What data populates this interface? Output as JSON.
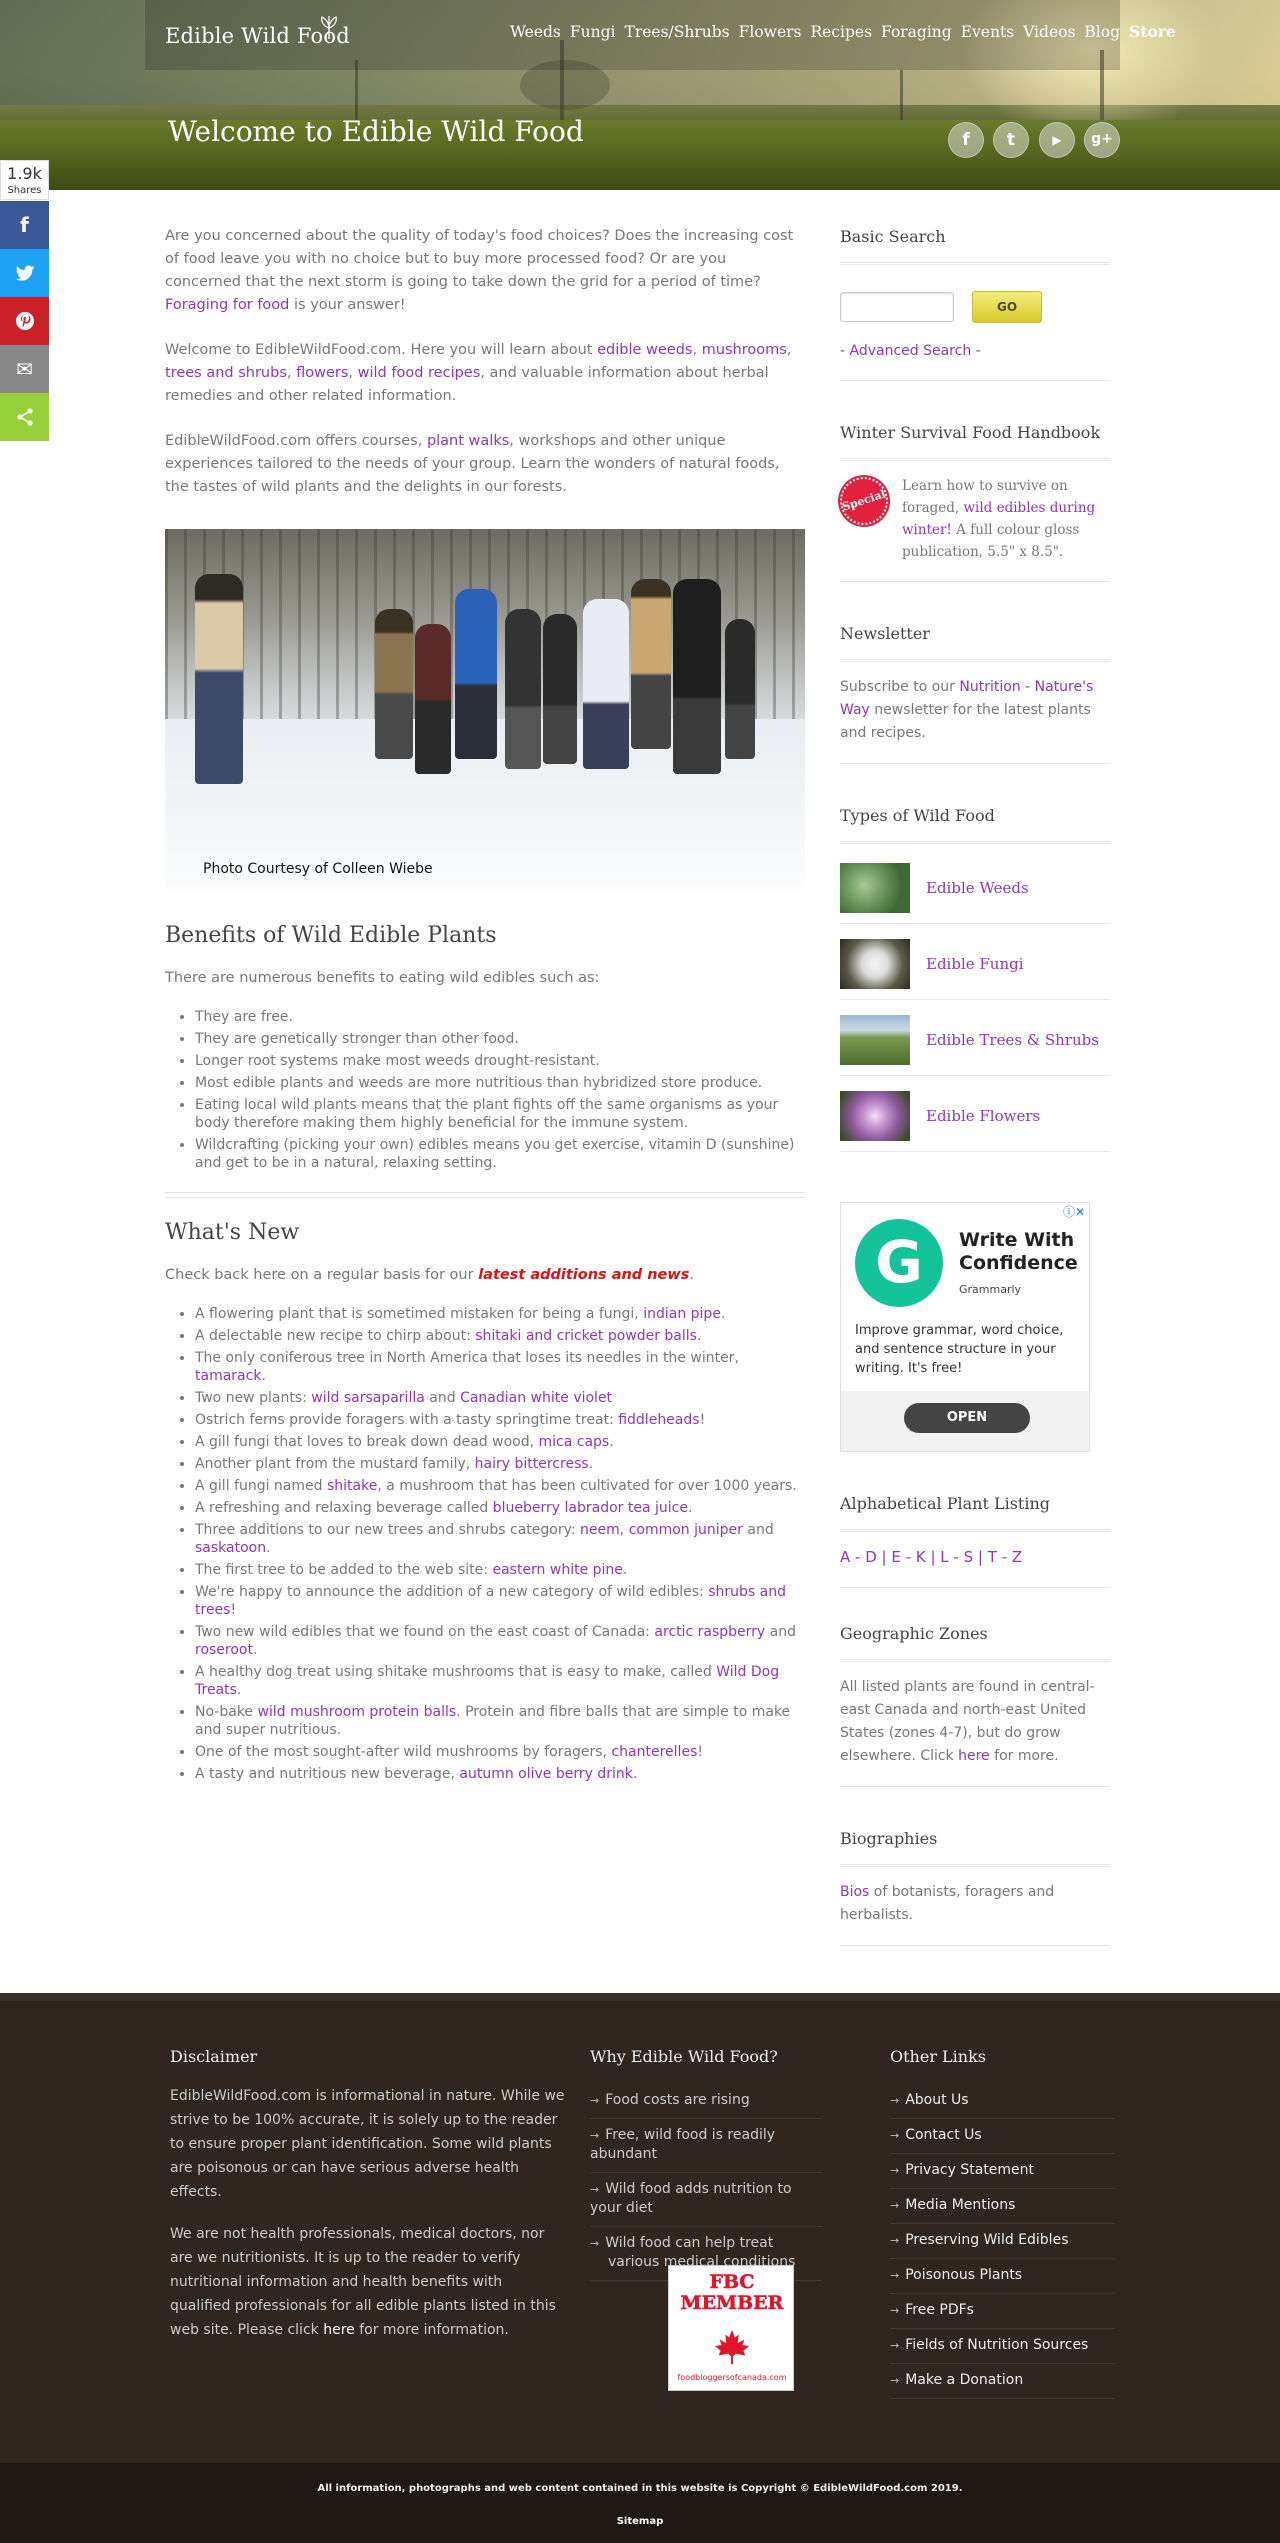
{
  "header": {
    "logo": "Edible Wild Food",
    "nav": [
      "Weeds",
      "Fungi",
      "Trees/Shrubs",
      "Flowers",
      "Recipes",
      "Foraging",
      "Events",
      "Videos",
      "Blog",
      "Store"
    ],
    "title": "Welcome to Edible Wild Food",
    "social_icons": [
      "facebook-icon",
      "twitter-icon",
      "youtube-icon",
      "google-plus-icon"
    ],
    "social_glyphs": [
      "f",
      "t",
      "▶",
      "g+"
    ]
  },
  "share": {
    "count": "1.9k",
    "count_label": "Shares",
    "buttons": [
      {
        "name": "facebook",
        "glyph": "f",
        "color": "#3b5998"
      },
      {
        "name": "twitter",
        "glyph": "🐦",
        "color": "#1da1f2"
      },
      {
        "name": "pinterest",
        "glyph": "P",
        "color": "#cb2027"
      },
      {
        "name": "email",
        "glyph": "✉",
        "color": "#888888"
      },
      {
        "name": "sharethis",
        "glyph": "⋖",
        "color": "#95d03a"
      }
    ]
  },
  "intro": {
    "p1": [
      "Are you concerned about the quality of today's food choices? Does the increasing cost of food leave you with no choice but to buy more processed food? Or are you concerned that the next storm is going to take down the grid for a period of time? ",
      "Foraging for food",
      " is your answer!"
    ],
    "p2": [
      "Welcome to EdibleWildFood.com. Here you will learn about ",
      "edible weeds",
      ", ",
      "mushrooms",
      ", ",
      "trees and shrubs",
      ", ",
      "flowers",
      ", ",
      "wild food recipes",
      ", and valuable information about herbal remedies and other related information."
    ],
    "p3": [
      "EdibleWildFood.com offers courses, ",
      "plant walks",
      ", workshops and other unique experiences tailored to the needs of your group. Learn the wonders of natural foods, the tastes of wild plants and the delights in our forests."
    ]
  },
  "photo": {
    "caption": "Photo Courtesy of Colleen Wiebe"
  },
  "benefits": {
    "title": "Benefits of Wild Edible Plants",
    "intro": "There are numerous benefits to eating wild edibles such as:",
    "items": [
      "They are free.",
      "They are genetically stronger than other food.",
      "Longer root systems make most weeds drought-resistant.",
      "Most edible plants and weeds are more nutritious than hybridized store produce.",
      "Eating local wild plants means that the plant fights off the same organisms as your body therefore making them highly beneficial for the immune system.",
      "Wildcrafting (picking your own) edibles means you get exercise, vitamin D (sunshine) and get to be in a natural, relaxing setting."
    ]
  },
  "whats_new": {
    "title": "What's New",
    "intro_before": "Check back here on a regular basis for our ",
    "intro_highlight": "latest additions and news",
    "intro_after": ".",
    "items": [
      [
        "A flowering plant that is sometimed mistaken for being a fungi, ",
        "indian pipe",
        "."
      ],
      [
        "A delectable new recipe to chirp about: ",
        "shitaki and cricket powder balls",
        "."
      ],
      [
        "The only coniferous tree in North America that loses its needles in the winter, ",
        "tamarack",
        "."
      ],
      [
        "Two new plants: ",
        "wild sarsaparilla",
        " and ",
        "Canadian white violet",
        ""
      ],
      [
        "Ostrich ferns provide foragers with a tasty springtime treat: ",
        "fiddleheads",
        "!"
      ],
      [
        "A gill fungi that loves to break down dead wood, ",
        "mica caps",
        "."
      ],
      [
        "Another plant from the mustard family, ",
        "hairy bittercress",
        "."
      ],
      [
        "A gill fungi named ",
        "shitake",
        ", a mushroom that has been cultivated for over 1000 years."
      ],
      [
        "A refreshing and relaxing beverage called ",
        "blueberry labrador tea juice",
        "."
      ],
      [
        "Three additions to our new trees and shrubs category: ",
        "neem",
        ", ",
        "common juniper",
        " and ",
        "saskatoon",
        "."
      ],
      [
        "The first tree to be added to the web site: ",
        "eastern white pine",
        "."
      ],
      [
        "We're happy to announce the addition of a new category of wild edibles: ",
        "shrubs and trees",
        "!"
      ],
      [
        "Two new wild edibles that we found on the east coast of Canada: ",
        "arctic raspberry",
        " and ",
        "roseroot",
        "."
      ],
      [
        "A healthy dog treat using shitake mushrooms that is easy to make, called ",
        "Wild Dog Treats",
        "."
      ],
      [
        "No-bake ",
        "wild mushroom protein balls",
        ". Protein and fibre balls that are simple to make and super nutritious."
      ],
      [
        "One of the most sought-after wild mushrooms by foragers, ",
        "chanterelles",
        "!"
      ],
      [
        "A tasty and nutritious new beverage, ",
        "autumn olive berry drink",
        "."
      ]
    ]
  },
  "sidebar": {
    "search": {
      "title": "Basic Search",
      "button": "GO",
      "advanced": "- Advanced Search -"
    },
    "handbook": {
      "title": "Winter Survival Food Handbook",
      "badge": "Special",
      "text": [
        "Learn how to survive on foraged, ",
        "wild edibles during winter!",
        " A full colour gloss publication, 5.5\" x 8.5\"."
      ]
    },
    "newsletter": {
      "title": "Newsletter",
      "text": [
        "Subscribe to our ",
        "Nutrition - Nature's Way",
        " newsletter for the latest plants and recipes."
      ]
    },
    "types": {
      "title": "Types of Wild Food",
      "items": [
        "Edible Weeds",
        "Edible Fungi",
        "Edible Trees & Shrubs",
        "Edible Flowers"
      ]
    },
    "ad": {
      "headline": "Write With Confidence",
      "brand": "Grammarly",
      "body": "Improve grammar, word choice, and sentence structure in your writing. It's free!",
      "button": "OPEN",
      "logo_letter": "G"
    },
    "alpha": {
      "title": "Alphabetical Plant Listing",
      "links": [
        "A - D",
        "E - K",
        "L - S",
        "T - Z"
      ]
    },
    "geo": {
      "title": "Geographic Zones",
      "text": [
        "All listed plants are found in central-east Canada and north-east United States (zones 4-7), but do grow elsewhere. Click ",
        "here",
        " for more."
      ]
    },
    "bios": {
      "title": "Biographies",
      "text": [
        "Bios",
        " of botanists, foragers and herbalists."
      ]
    }
  },
  "footer": {
    "disclaimer": {
      "title": "Disclaimer",
      "p1": "EdibleWildFood.com is informational in nature. While we strive to be 100% accurate, it is solely up to the reader to ensure proper plant identification. Some wild plants are poisonous or can have serious adverse health effects.",
      "p2": [
        "We are not health professionals, medical doctors, nor are we nutritionists. It is up to the reader to verify nutritional information and health benefits with qualified professionals for all edible plants listed in this web site. Please click ",
        "here",
        " for more information."
      ]
    },
    "why": {
      "title": "Why Edible Wild Food?",
      "items": [
        "Food costs are rising",
        "Free, wild food is readily abundant",
        "Wild food adds nutrition to your diet",
        "Wild food can help treat various medical conditions"
      ]
    },
    "fbc": {
      "line1": "FBC",
      "line2": "MEMBER",
      "url": "foodbloggersofcanada.com"
    },
    "other": {
      "title": "Other Links",
      "items": [
        "About Us",
        "Contact Us",
        "Privacy Statement",
        "Media Mentions",
        "Preserving Wild Edibles",
        "Poisonous Plants",
        "Free PDFs",
        "Fields of Nutrition Sources",
        "Make a Donation"
      ]
    },
    "copyright": "All information, photographs and web content contained in this website is Copyright © EdibleWildFood.com 2019.",
    "sitemap": "Sitemap"
  }
}
